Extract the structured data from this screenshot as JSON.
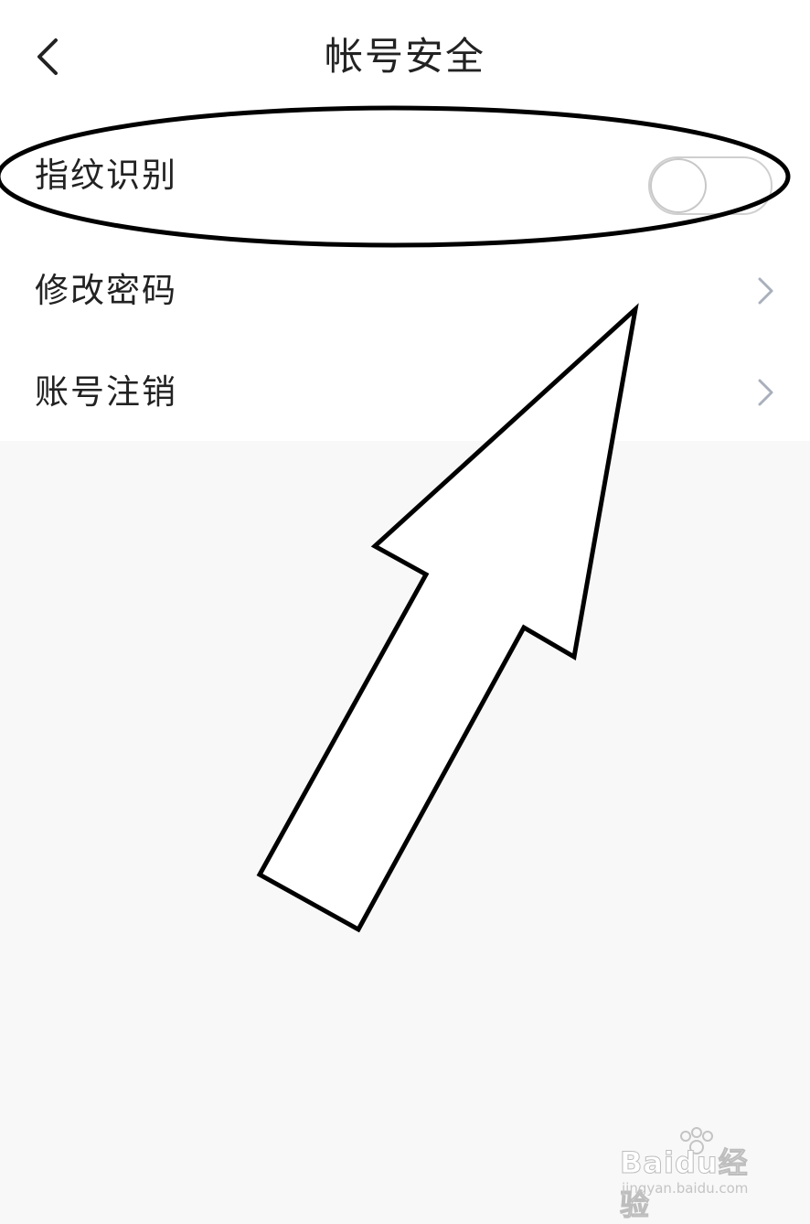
{
  "header": {
    "title": "帐号安全",
    "back_icon": "chevron-left-icon"
  },
  "settings": {
    "fingerprint": {
      "label": "指纹识别",
      "enabled": false
    },
    "change_password": {
      "label": "修改密码",
      "icon": "chevron-right-icon"
    },
    "account_cancel": {
      "label": "账号注销",
      "icon": "chevron-right-icon"
    }
  },
  "watermark": {
    "logo": "Baidu经验",
    "sub": "jingyan.baidu.com"
  },
  "colors": {
    "page_bg": "#f8f8f8",
    "card_bg": "#ffffff",
    "text": "#222222",
    "chevron": "#a9b0bc",
    "annotation": "#000000"
  }
}
